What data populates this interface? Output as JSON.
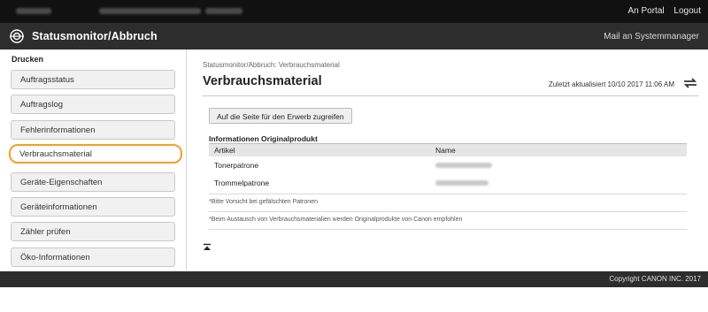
{
  "topbar": {
    "links": [
      "An Portal",
      "Logout"
    ]
  },
  "titlebar": {
    "title": "Statusmonitor/Abbruch",
    "mail_admin": "Mail an Systemmanager",
    "icon": "target-icon"
  },
  "sidebar": {
    "heading": "Drucken",
    "items": [
      {
        "label": "Auftragsstatus"
      },
      {
        "label": "Auftragslog"
      },
      {
        "label": "Fehlerinformationen"
      },
      {
        "label": "Verbrauchsmaterial",
        "active": true
      },
      {
        "label": "Geräte-Eigenschaften"
      },
      {
        "label": "Geräteinformationen"
      },
      {
        "label": "Zähler prüfen"
      },
      {
        "label": "Öko-Informationen"
      }
    ],
    "accent": "#f0a030"
  },
  "main": {
    "breadcrumb": "Statusmonitor/Abbruch: Verbrauchsmaterial",
    "title": "Verbrauchsmaterial",
    "last_updated": "Zuletzt aktualisiert 10/10 2017 11:06 AM",
    "buy_button": "Auf die Seite für den Erwerb zugreifen",
    "section_title": "Informationen Originalprodukt",
    "table": {
      "headers": [
        "Artikel",
        "Name"
      ],
      "rows": [
        [
          "Tonerpatrone",
          ""
        ],
        [
          "Trommelpatrone",
          ""
        ]
      ]
    },
    "notes": [
      "*Bitte Vorsicht bei gefälschten Patronen",
      "*Beim Austausch von Verbrauchsmaterialien werden Originalprodukte von Canon empfohlen"
    ]
  },
  "footer": {
    "copyright": "Copyright CANON INC. 2017"
  }
}
